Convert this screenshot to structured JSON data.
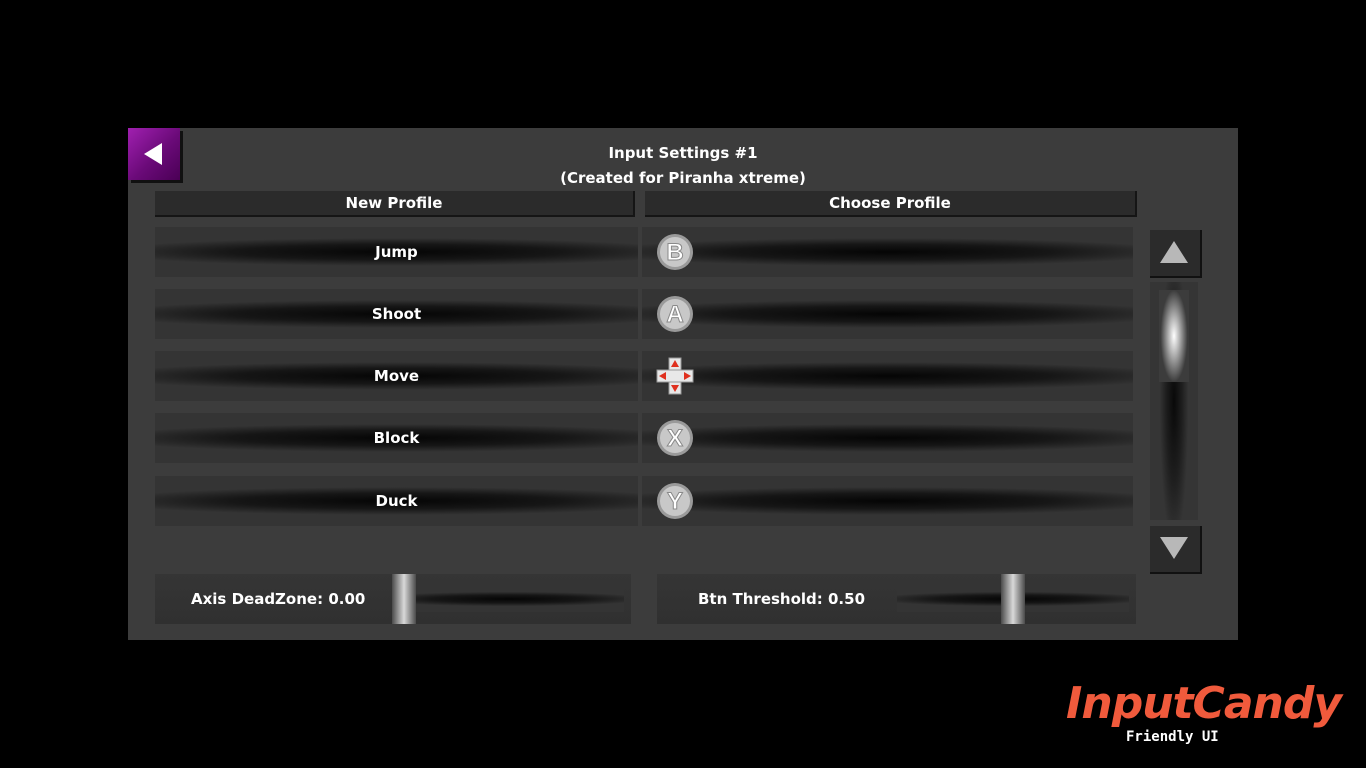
{
  "header": {
    "title": "Input Settings #1",
    "subtitle": "(Created for Piranha xtreme)",
    "new_profile": "New Profile",
    "choose_profile": "Choose Profile"
  },
  "bindings": [
    {
      "action": "Jump",
      "glyph": "B",
      "icon": "b-button-icon"
    },
    {
      "action": "Shoot",
      "glyph": "A",
      "icon": "a-button-icon"
    },
    {
      "action": "Move",
      "glyph": "",
      "icon": "dpad-icon"
    },
    {
      "action": "Block",
      "glyph": "X",
      "icon": "x-button-icon"
    },
    {
      "action": "Duck",
      "glyph": "Y",
      "icon": "y-button-icon"
    }
  ],
  "sliders": {
    "axis_deadzone": {
      "label": "Axis DeadZone: 0.00",
      "value": 0.0
    },
    "btn_threshold": {
      "label": "Btn Threshold: 0.50",
      "value": 0.5
    }
  },
  "logo": {
    "title": "InputCandy",
    "subtitle": "Friendly UI"
  },
  "colors": {
    "accent": "#8b1a9a",
    "logo": "#f05a3c",
    "panel": "#3c3c3c",
    "dpad_arrow": "#e0301e"
  }
}
